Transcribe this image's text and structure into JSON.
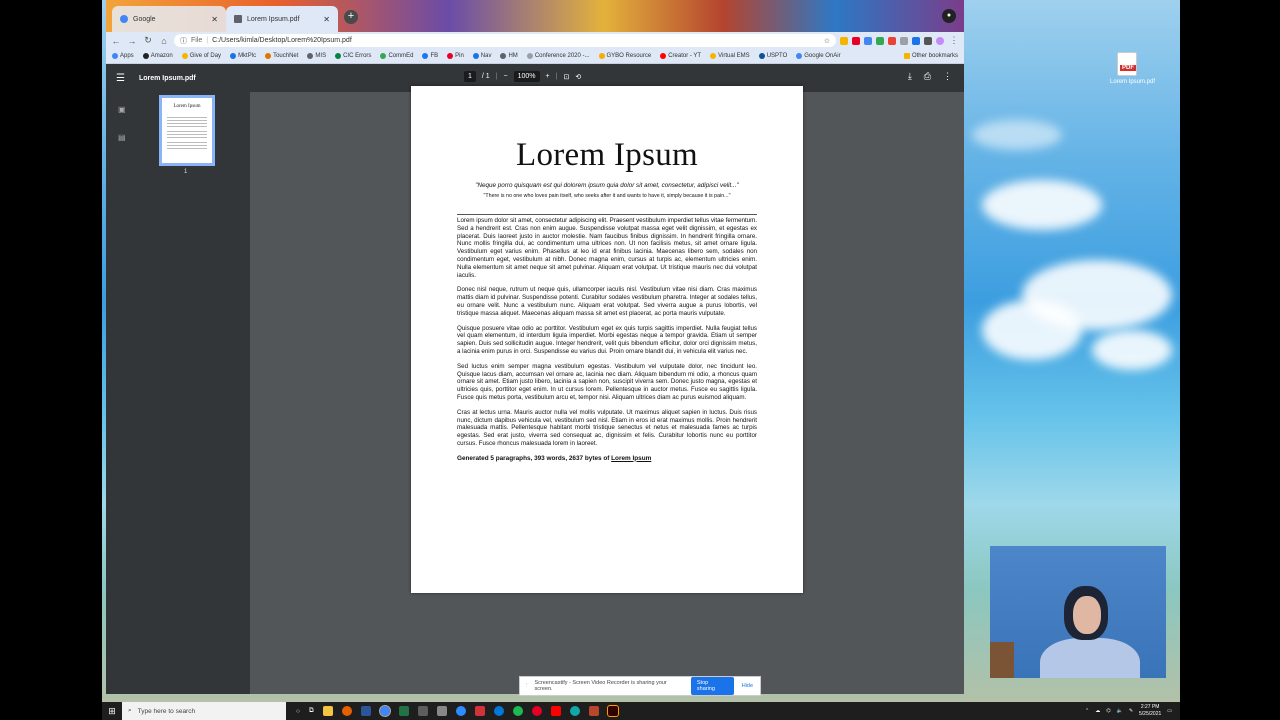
{
  "desktop": {
    "icon_label": "Lorem Ipsum.pdf",
    "icon_badge": "PDF"
  },
  "browser": {
    "tabs": [
      {
        "label": "Google"
      },
      {
        "label": "Lorem Ipsum.pdf"
      }
    ],
    "address": {
      "scheme": "File",
      "url": "C:/Users/kimla/Desktop/Lorem%20Ipsum.pdf"
    },
    "bookmarks": [
      "Apps",
      "Amazon",
      "Give of Day",
      "MktPlc",
      "TouchNet",
      "MIS",
      "CIC Errors",
      "CommEd",
      "FB",
      "Pin",
      "Nav",
      "HM",
      "Conference 2020 -...",
      "GYBO Resource",
      "Creator - YT",
      "Virtual EMS",
      "USPTO",
      "Google OnAir"
    ],
    "other_bookmarks": "Other bookmarks"
  },
  "pdf_viewer": {
    "title": "Lorem Ipsum.pdf",
    "page_current": "1",
    "page_total": "/ 1",
    "zoom": "100%",
    "thumbnail_page": "1"
  },
  "document": {
    "title": "Lorem Ipsum",
    "quote": "\"Neque porro quisquam est qui dolorem ipsum quia dolor sit amet, consectetur, adipisci velit...\"",
    "quote_translation": "\"There is no one who loves pain itself, who seeks after it and wants to have it, simply because it is pain...\"",
    "paragraphs": [
      "Lorem ipsum dolor sit amet, consectetur adipiscing elit. Praesent vestibulum imperdiet tellus vitae fermentum. Sed a hendrerit est. Cras non enim augue. Suspendisse volutpat massa eget velit dignissim, et egestas ex placerat. Duis laoreet justo in auctor molestie. Nam faucibus finibus dignissim. In hendrerit fringilla ornare. Nunc mollis fringilla dui, ac condimentum urna ultrices non. Ut non facilisis metus, sit amet ornare ligula. Vestibulum eget varius enim. Phasellus at leo id erat finibus lacinia. Maecenas libero sem, sodales non condimentum eget, vestibulum at nibh. Donec magna enim, cursus at turpis ac, elementum ultricies enim. Nulla elementum sit amet neque sit amet pulvinar. Aliquam erat volutpat. Ut tristique mauris nec dui volutpat iaculis.",
      "Donec nisl neque, rutrum ut neque quis, ullamcorper iaculis nisl. Vestibulum vitae nisi diam. Cras maximus mattis diam id pulvinar. Suspendisse potenti. Curabitur sodales vestibulum pharetra. Integer at sodales tellus, eu ornare velit. Nunc a vestibulum nunc. Aliquam erat volutpat. Sed viverra augue a purus lobortis, vel tristique massa aliquet. Maecenas aliquam massa sit amet est placerat, ac porta mauris vulputate.",
      "Quisque posuere vitae odio ac porttitor. Vestibulum eget ex quis turpis sagittis imperdiet. Nulla feugiat tellus vel quam elementum, id interdum ligula imperdiet. Morbi egestas neque a tempor gravida. Etiam ut semper sapien. Duis sed sollicitudin augue. Integer hendrerit, velit quis bibendum efficitur, dolor orci dignissim metus, a lacinia enim purus in orci. Suspendisse eu varius dui. Proin ornare blandit dui, in vehicula elit varius nec.",
      "Sed luctus enim semper magna vestibulum egestas. Vestibulum vel vulputate dolor, nec tincidunt leo. Quisque lacus diam, accumsan vel ornare ac, lacinia nec diam. Aliquam bibendum mi odio, a rhoncus quam ornare sit amet. Etiam justo libero, lacinia a sapien non, suscipit viverra sem. Donec justo magna, egestas et ultricies quis, porttitor eget enim. In ut cursus lorem. Pellentesque in auctor metus. Fusce eu sagittis ligula. Fusce quis metus porta, vestibulum arcu et, tempor nisi. Aliquam ultrices diam ac purus euismod aliquam.",
      "Cras at lectus urna. Mauris auctor nulla vel mollis vulputate. Ut maximus aliquet sapien in luctus. Duis risus nunc, dictum dapibus vehicula vel, vestibulum sed nisl. Etiam in eros id erat maximus mollis. Proin hendrerit malesuada mattis. Pellentesque habitant morbi tristique senectus et netus et malesuada fames ac turpis egestas. Sed erat justo, viverra sed consequat ac, dignissim et felis. Curabitur lobortis nunc eu porttitor cursus. Fusce rhoncus malesuada lorem in laoreet."
    ],
    "generated_prefix": "Generated 5 paragraphs, 393 words, 2637 bytes of ",
    "generated_link": "Lorem Ipsum"
  },
  "share_bar": {
    "message": "Screencastify - Screen Video Recorder is sharing your screen.",
    "stop_label": "Stop sharing",
    "hide_label": "Hide"
  },
  "taskbar": {
    "search_placeholder": "Type here to search",
    "time": "2:27 PM",
    "date": "5/25/2021"
  }
}
